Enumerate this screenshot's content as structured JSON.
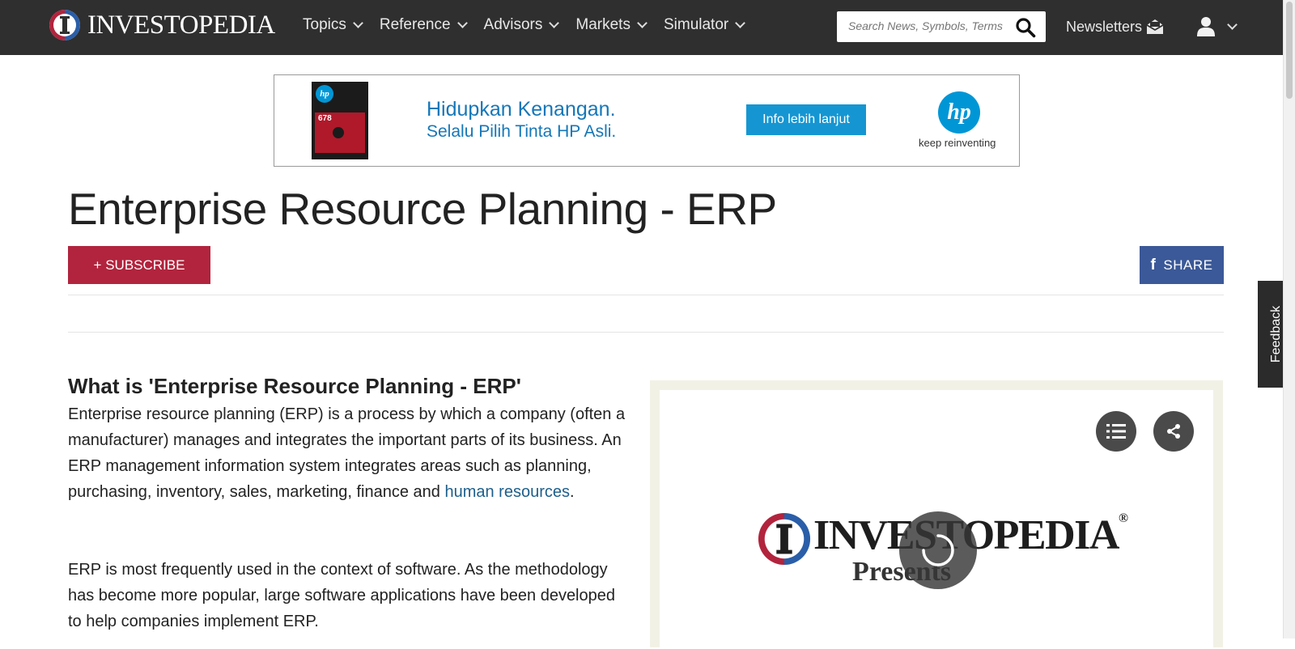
{
  "header": {
    "logo_text": "INVESTOPEDIA",
    "nav": [
      "Topics",
      "Reference",
      "Advisors",
      "Markets",
      "Simulator"
    ],
    "search_placeholder": "Search News, Symbols, Terms",
    "newsletters_label": "Newsletters"
  },
  "ad": {
    "product_brand": "hp",
    "product_number": "678",
    "headline": "Hidupkan Kenangan.",
    "subline": "Selalu Pilih Tinta HP Asli.",
    "cta": "Info lebih lanjut",
    "logo": "hp",
    "tagline": "keep reinventing"
  },
  "page": {
    "title": "Enterprise Resource Planning - ERP",
    "subscribe_label": "+ SUBSCRIBE",
    "share_label": "SHARE",
    "share_icon": "f"
  },
  "article": {
    "heading": "What is 'Enterprise Resource Planning - ERP'",
    "p1_text": "Enterprise resource planning (ERP) is a process by which a company (often a manufacturer) manages and integrates the important parts of its business. An ERP management information system integrates areas such as planning, purchasing, inventory, sales, marketing, finance and ",
    "p1_link": "human resources",
    "p1_end": ".",
    "p2": "ERP is most frequently used in the context of software. As the methodology has become more popular, large software applications have been developed to help companies implement ERP."
  },
  "video": {
    "logo_text": "INVESTOPEDIA",
    "reg_mark": "®",
    "presents": "Presents"
  },
  "feedback_label": "Feedback",
  "colors": {
    "header_bg": "#2f2f2f",
    "subscribe": "#b2243d",
    "facebook": "#3b5998",
    "link": "#1d5f8a",
    "ad_blue": "#1577b8"
  }
}
